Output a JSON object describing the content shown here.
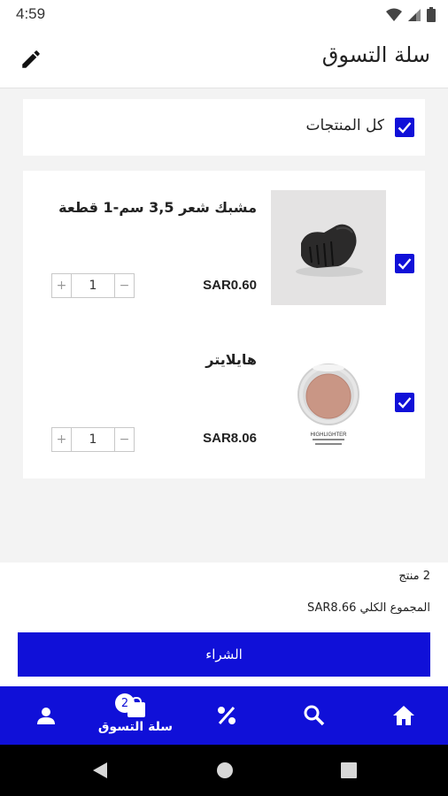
{
  "status": {
    "time": "4:59"
  },
  "appbar": {
    "title": "سلة التسوق",
    "edit_icon": "pencil-icon"
  },
  "select_all": {
    "label": "كل المنتجات",
    "checked": true
  },
  "items": [
    {
      "name": "مشبك شعر 3,5 سم-1 قطعة",
      "price": "SAR0.60",
      "quantity": "1",
      "checked": true,
      "image": "hair-clip-photo"
    },
    {
      "name": "هايلايتر",
      "price": "SAR8.06",
      "quantity": "1",
      "checked": true,
      "image": "highlighter-compact-photo",
      "image_caption": "HIGHLIGHTER"
    }
  ],
  "stepper": {
    "plus": "+",
    "minus": "−"
  },
  "summary": {
    "count_text": "2 منتج",
    "total_text": "المجموع الكلي SAR8.66"
  },
  "buy_button": {
    "label": "الشراء"
  },
  "bottom_nav": {
    "cart": {
      "label": "سلة التسوق",
      "badge": "2",
      "icon": "cart-icon"
    },
    "profile": {
      "icon": "person-icon"
    },
    "offers": {
      "icon": "percent-icon"
    },
    "search": {
      "icon": "search-icon"
    },
    "home": {
      "icon": "home-icon"
    }
  },
  "colors": {
    "accent": "#1010d8",
    "background": "#f3f3f3",
    "card": "#ffffff"
  }
}
